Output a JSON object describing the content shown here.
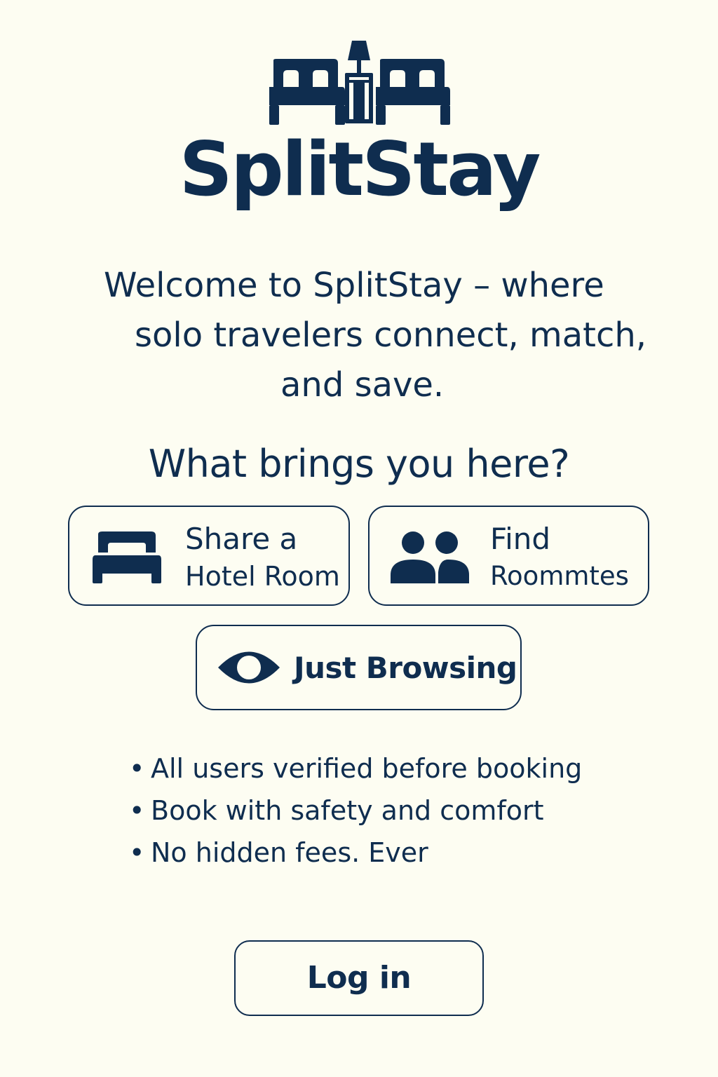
{
  "app": {
    "name": "SplitStay"
  },
  "welcome": {
    "line1": "Welcome to SplitStay – where",
    "line2": "solo travelers connect, match,",
    "line3": "and save."
  },
  "question": "What brings you here?",
  "options": [
    {
      "line1": "Share a",
      "line2": "Hotel Room",
      "icon": "bed-icon"
    },
    {
      "line1": "Find",
      "line2": "Roommtes",
      "icon": "people-icon"
    },
    {
      "label": "Just Browsing",
      "icon": "eye-icon"
    }
  ],
  "features": [
    "All users verified before booking",
    "Book with safety and comfort",
    "No hidden fees. Ever"
  ],
  "bullet": "•",
  "login": {
    "label": "Log in"
  },
  "colors": {
    "primary": "#0f2d4f",
    "background": "#fdfdf2"
  }
}
